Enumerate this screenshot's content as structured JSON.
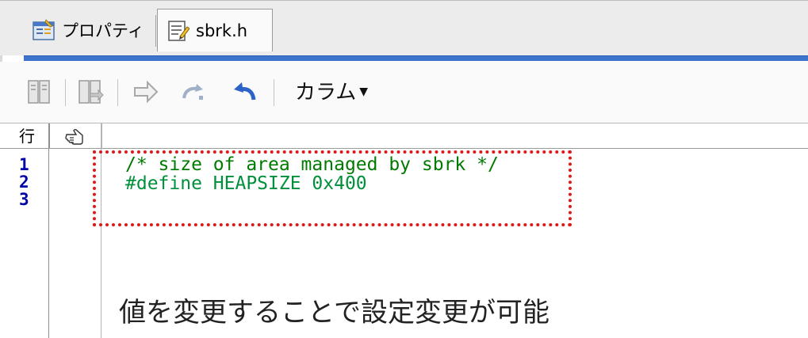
{
  "tabs": [
    {
      "label": "プロパティ",
      "icon": "properties-window-icon",
      "active": false
    },
    {
      "label": "sbrk.h",
      "icon": "header-file-icon",
      "active": true
    }
  ],
  "toolbar": {
    "buttons": [
      {
        "icon": "toggle-bookmark-icon"
      },
      {
        "icon": "next-bookmark-icon"
      },
      {
        "icon": "go-forward-arrow-icon"
      },
      {
        "icon": "redo-icon"
      },
      {
        "icon": "undo-icon"
      }
    ],
    "column_menu_label": "カラム"
  },
  "editor": {
    "header_line_label": "行",
    "header_marker_icon": "pointing-hand-icon",
    "line_numbers": [
      "1",
      "2",
      "3"
    ],
    "lines": [
      {
        "text": "/* size of area managed by sbrk */",
        "kind": "comment"
      },
      {
        "directive": "#define",
        "rest": " HEAPSIZE 0x400"
      },
      {
        "text": ""
      }
    ],
    "annotation": "値を変更することで設定変更が可能"
  },
  "colors": {
    "accent_bar": "#3d74ce",
    "comment": "#007a00",
    "directive": "#008f3a",
    "line_number": "#0000aa",
    "highlight_box": "#e01818"
  }
}
